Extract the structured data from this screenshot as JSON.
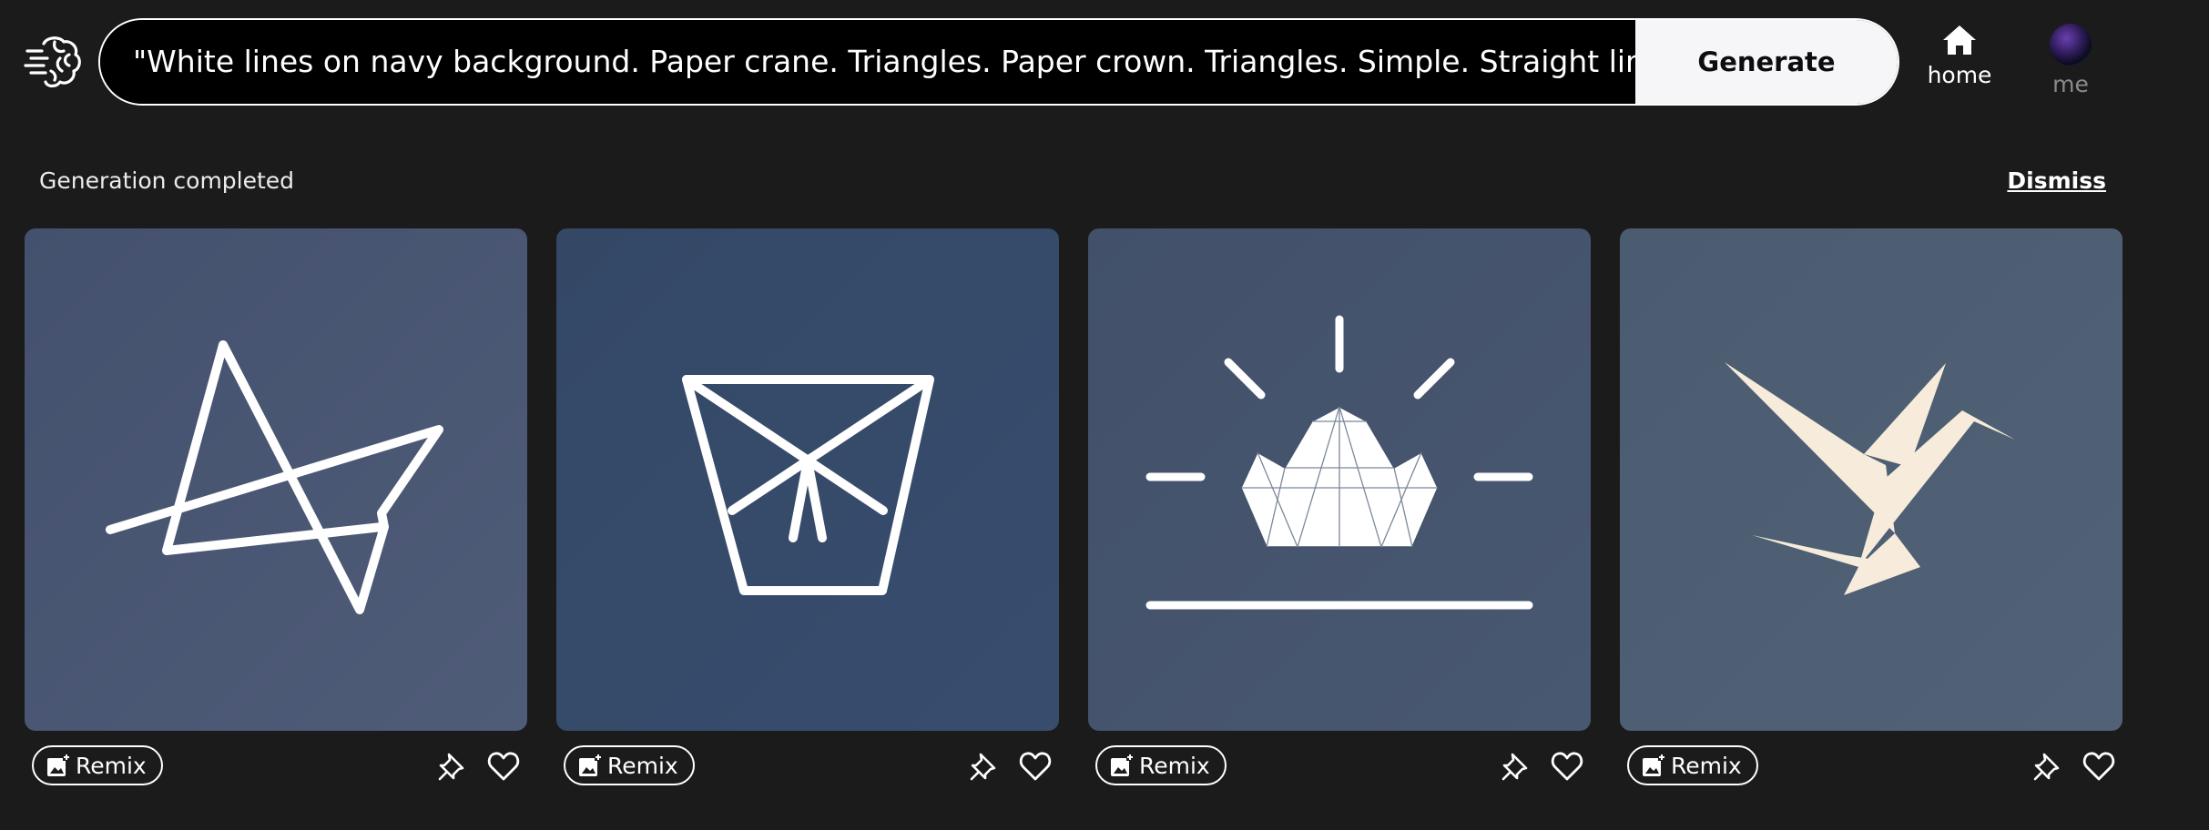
{
  "header": {
    "logo_icon": "brain-speed-icon",
    "prompt_value": "\"White lines on navy background. Paper crane. Triangles. Paper crown. Triangles. Simple. Straight lines.",
    "generate_label": "Generate",
    "nav": {
      "home": {
        "label": "home",
        "icon": "home-icon"
      },
      "me": {
        "label": "me",
        "icon": "avatar"
      }
    }
  },
  "status": {
    "message": "Generation completed",
    "dismiss_label": "Dismiss"
  },
  "results": [
    {
      "remix_label": "Remix",
      "background": "#4a5775",
      "subject": "abstract line crane"
    },
    {
      "remix_label": "Remix",
      "background": "#364a6b",
      "subject": "geometric paper crown"
    },
    {
      "remix_label": "Remix",
      "background": "#44546b",
      "subject": "crown with rays"
    },
    {
      "remix_label": "Remix",
      "background": "#4e5f72",
      "subject": "cream origami crane"
    }
  ],
  "colors": {
    "page_bg": "#1b1b1b",
    "line_white": "#ffffff",
    "crane_cream": "#f7ecdc"
  }
}
